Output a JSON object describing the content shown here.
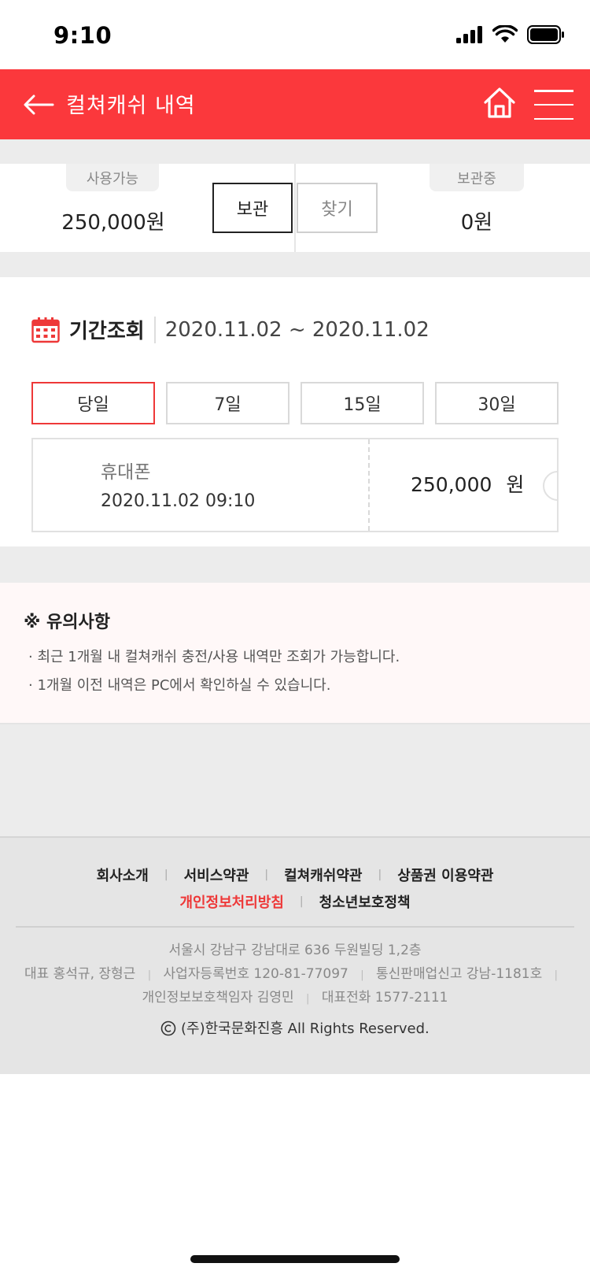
{
  "status_bar": {
    "time": "9:10"
  },
  "header": {
    "title": "컬쳐캐쉬 내역"
  },
  "balance": {
    "available_label": "사용가능",
    "available_amount": "250,000원",
    "store_button": "보관",
    "find_button": "찾기",
    "stored_label": "보관중",
    "stored_amount": "0원"
  },
  "period": {
    "label": "기간조회",
    "range": "2020.11.02 ~ 2020.11.02",
    "filters": [
      "당일",
      "7일",
      "15일",
      "30일"
    ],
    "selected_filter": "당일"
  },
  "history": [
    {
      "name": "휴대폰",
      "datetime": "2020.11.02 09:10",
      "amount": "250,000",
      "unit": "원"
    }
  ],
  "notice": {
    "title": "※ 유의사항",
    "items": [
      "· 최근 1개월 내 컬쳐캐쉬 충전/사용 내역만 조회가 가능합니다.",
      "· 1개월 이전 내역은 PC에서 확인하실 수 있습니다."
    ]
  },
  "footer": {
    "links_row1": [
      "회사소개",
      "서비스약관",
      "컬쳐캐쉬약관",
      "상품권 이용약관"
    ],
    "links_row2": [
      "개인정보처리방침",
      "청소년보호정책"
    ],
    "address": "서울시 강남구 강남대로 636 두원빌딩 1,2층",
    "ceo": "대표 홍석규, 장형근",
    "biz_no": "사업자등록번호 120-81-77097",
    "telecom": "통신판매업신고 강남-1181호",
    "privacy_officer": "개인정보보호책임자 김영민",
    "phone": "대표전화 1577-2111",
    "copyright": "(주)한국문화진흥 All Rights Reserved."
  },
  "colors": {
    "brand_red": "#fb383c",
    "active_border": "#ee3838"
  },
  "icons": [
    "signal-icon",
    "wifi-icon",
    "battery-icon",
    "back-arrow-icon",
    "home-icon",
    "menu-icon",
    "calendar-icon",
    "copyright-icon"
  ]
}
